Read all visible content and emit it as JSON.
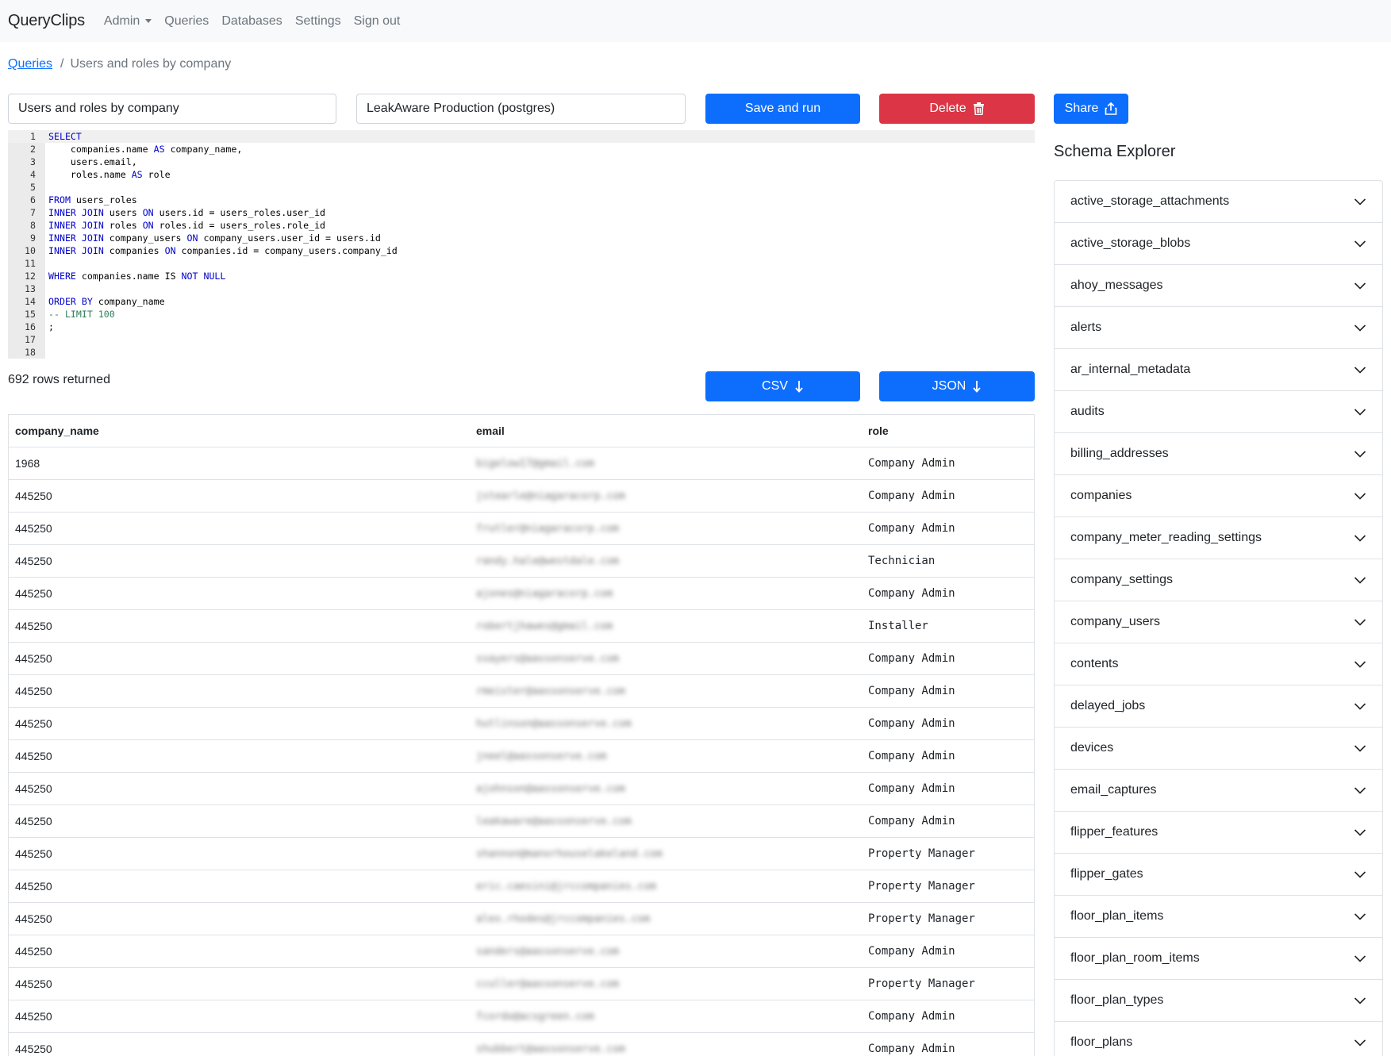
{
  "navbar": {
    "brand": "QueryClips",
    "admin": "Admin",
    "queries": "Queries",
    "databases": "Databases",
    "settings": "Settings",
    "signout": "Sign out"
  },
  "breadcrumb": {
    "link": "Queries",
    "separator": "/",
    "current": "Users and roles by company"
  },
  "form": {
    "query_name": "Users and roles by company",
    "database": "LeakAware Production (postgres)",
    "save_run_label": "Save and run",
    "delete_label": "Delete",
    "share_label": "Share"
  },
  "editor": {
    "lines": [
      {
        "n": "1",
        "text": "SELECT"
      },
      {
        "n": "2",
        "text": "    companies.name AS company_name,"
      },
      {
        "n": "3",
        "text": "    users.email,"
      },
      {
        "n": "4",
        "text": "    roles.name AS role"
      },
      {
        "n": "5",
        "text": ""
      },
      {
        "n": "6",
        "text": "FROM users_roles"
      },
      {
        "n": "7",
        "text": "INNER JOIN users ON users.id = users_roles.user_id"
      },
      {
        "n": "8",
        "text": "INNER JOIN roles ON roles.id = users_roles.role_id"
      },
      {
        "n": "9",
        "text": "INNER JOIN company_users ON company_users.user_id = users.id"
      },
      {
        "n": "10",
        "text": "INNER JOIN companies ON companies.id = company_users.company_id"
      },
      {
        "n": "11",
        "text": ""
      },
      {
        "n": "12",
        "text": "WHERE companies.name IS NOT NULL"
      },
      {
        "n": "13",
        "text": ""
      },
      {
        "n": "14",
        "text": "ORDER BY company_name"
      },
      {
        "n": "15",
        "text": "-- LIMIT 100"
      },
      {
        "n": "16",
        "text": ";"
      },
      {
        "n": "17",
        "text": ""
      },
      {
        "n": "18",
        "text": ""
      }
    ]
  },
  "results": {
    "rows_returned": "692 rows returned",
    "csv_label": "CSV",
    "json_label": "JSON",
    "columns": [
      "company_name",
      "email",
      "role"
    ],
    "rows": [
      {
        "company": "1968",
        "email": "bigelow17@gmail.com",
        "role": "Company Admin"
      },
      {
        "company": "445250",
        "email": "jstearle@niagaracorp.com",
        "role": "Company Admin"
      },
      {
        "company": "445250",
        "email": "frutler@niagaracorp.com",
        "role": "Company Admin"
      },
      {
        "company": "445250",
        "email": "randy.hale@westdale.com",
        "role": "Technician"
      },
      {
        "company": "445250",
        "email": "ajones@niagaracorp.com",
        "role": "Company Admin"
      },
      {
        "company": "445250",
        "email": "robertjhawes@gmail.com",
        "role": "Installer"
      },
      {
        "company": "445250",
        "email": "ssayers@aassonserve.com",
        "role": "Company Admin"
      },
      {
        "company": "445250",
        "email": "rmeister@aassonserve.com",
        "role": "Company Admin"
      },
      {
        "company": "445250",
        "email": "hutlinson@aassonserve.com",
        "role": "Company Admin"
      },
      {
        "company": "445250",
        "email": "jneel@aassonserve.com",
        "role": "Company Admin"
      },
      {
        "company": "445250",
        "email": "ajohnson@aassonserve.com",
        "role": "Company Admin"
      },
      {
        "company": "445250",
        "email": "leakaware@aassonserve.com",
        "role": "Company Admin"
      },
      {
        "company": "445250",
        "email": "shannon@manorhouselakeland.com",
        "role": "Property Manager"
      },
      {
        "company": "445250",
        "email": "eric.caesini@jrccompanies.com",
        "role": "Property Manager"
      },
      {
        "company": "445250",
        "email": "alex.rhodes@jrccompanies.com",
        "role": "Property Manager"
      },
      {
        "company": "445250",
        "email": "sanders@aassonserve.com",
        "role": "Company Admin"
      },
      {
        "company": "445250",
        "email": "cculler@aassonserve.com",
        "role": "Property Manager"
      },
      {
        "company": "445250",
        "email": "fcordo@acsgreen.com",
        "role": "Company Admin"
      },
      {
        "company": "445250",
        "email": "shubbert@aassonserve.com",
        "role": "Company Admin"
      }
    ]
  },
  "schema": {
    "title": "Schema Explorer",
    "tables": [
      "active_storage_attachments",
      "active_storage_blobs",
      "ahoy_messages",
      "alerts",
      "ar_internal_metadata",
      "audits",
      "billing_addresses",
      "companies",
      "company_meter_reading_settings",
      "company_settings",
      "company_users",
      "contents",
      "delayed_jobs",
      "devices",
      "email_captures",
      "flipper_features",
      "flipper_gates",
      "floor_plan_items",
      "floor_plan_room_items",
      "floor_plan_types",
      "floor_plans"
    ]
  },
  "icons": {
    "delete": "trash-icon",
    "share": "upload-icon",
    "download": "arrow-down-icon",
    "accordion": "chevron-down-icon"
  },
  "colors": {
    "primary": "#0d6efd",
    "danger": "#dc3545",
    "sql_keyword": "#0000cc",
    "sql_comment": "#2e7d5b"
  }
}
